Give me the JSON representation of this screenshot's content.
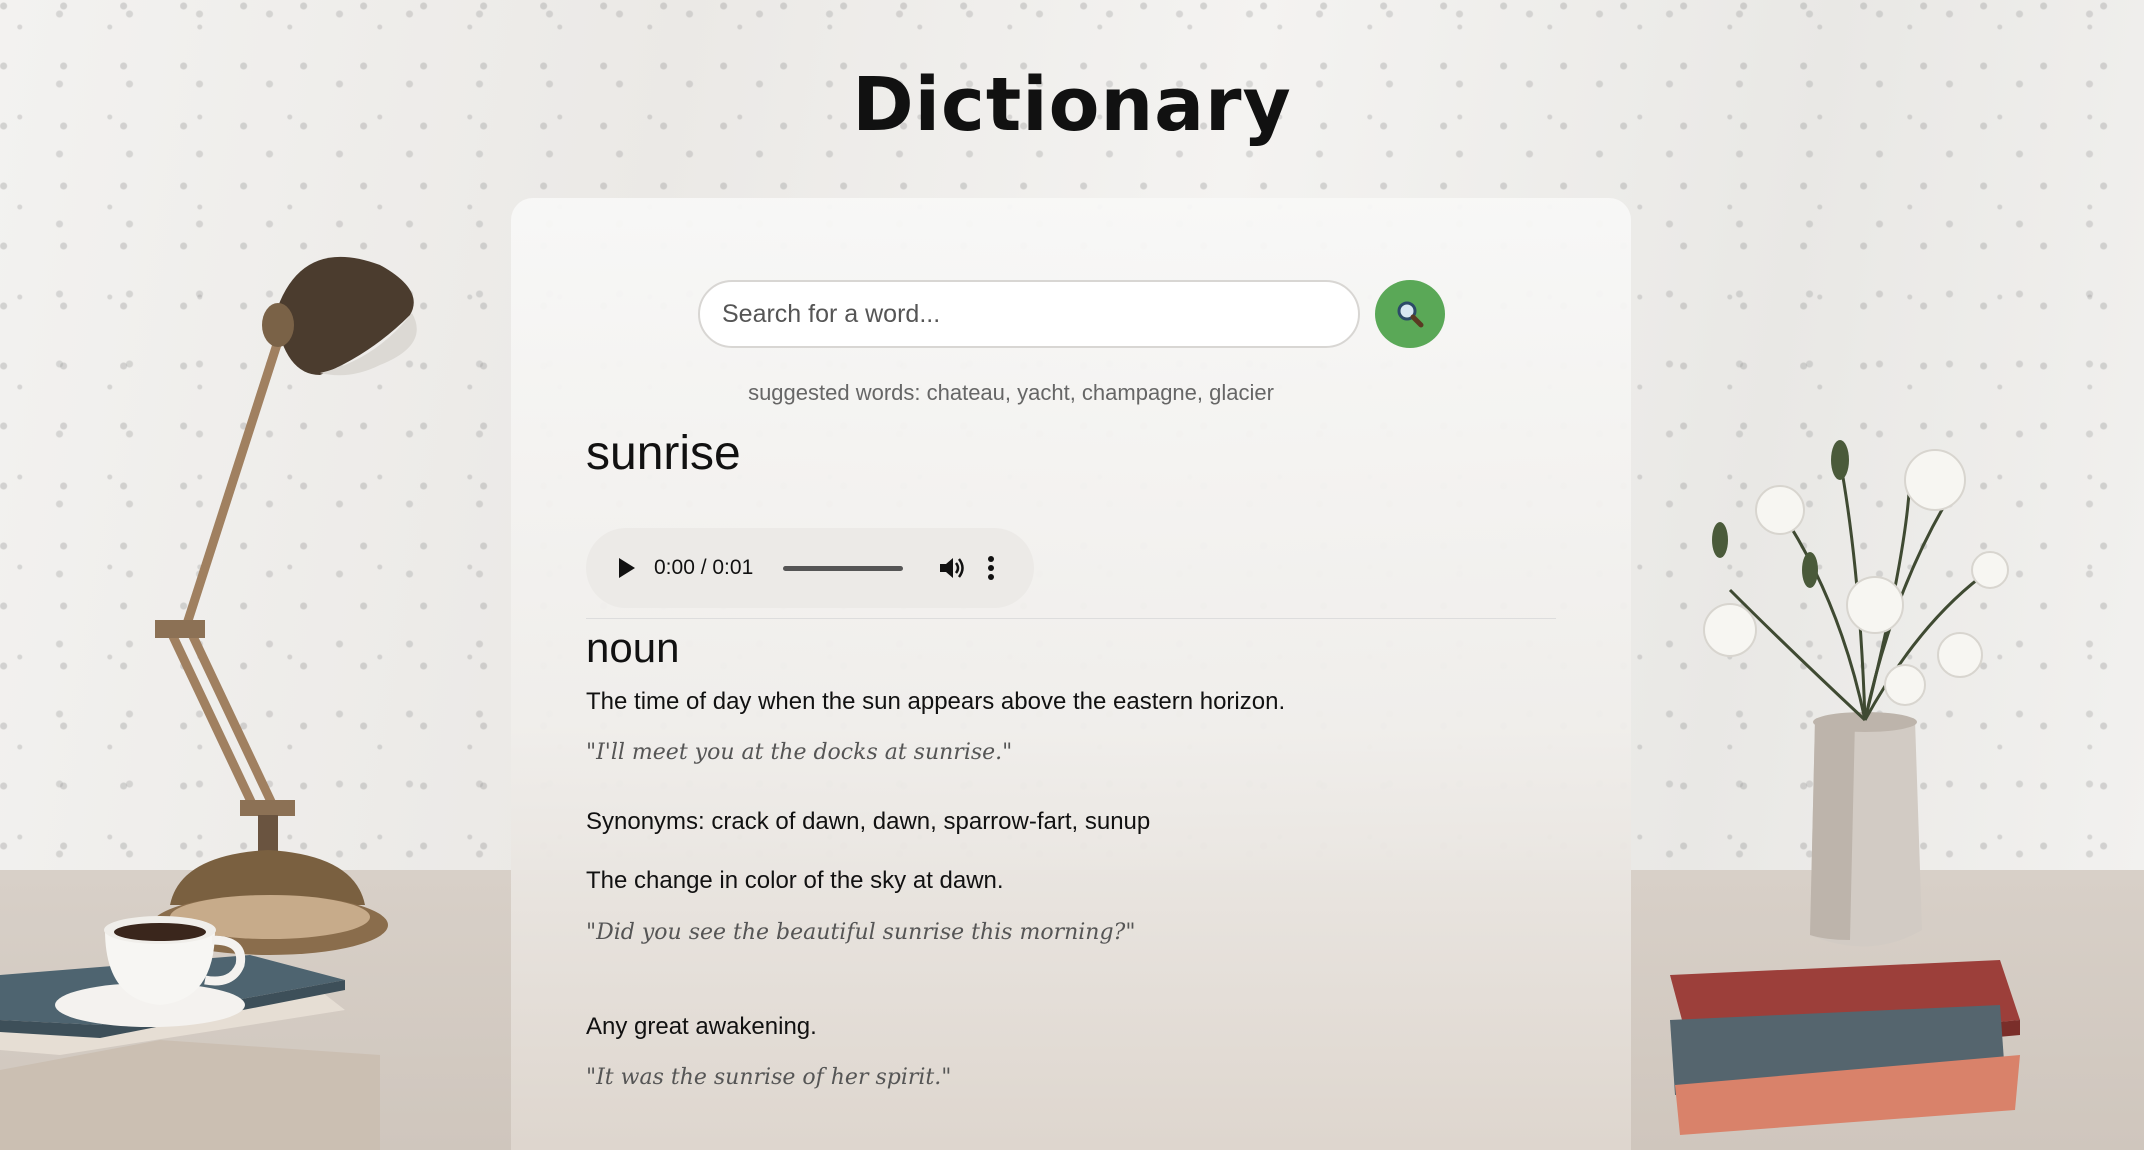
{
  "app": {
    "title": "Dictionary"
  },
  "search": {
    "placeholder": "Search for a word...",
    "button_icon": "magnifier-icon",
    "suggested": "suggested words: chateau, yacht, champagne, glacier"
  },
  "entry": {
    "word": "sunrise",
    "audio": {
      "time": "0:00 / 0:01",
      "progress": 0
    },
    "part_of_speech": "noun",
    "definitions": [
      {
        "text": "The time of day when the sun appears above the eastern horizon.",
        "example": "\"I'll meet you at the docks at sunrise.\""
      },
      {
        "text": "Synonyms: crack of dawn, dawn, sparrow-fart, sunup"
      },
      {
        "text": "The change in color of the sky at dawn.",
        "example": "\"Did you see the beautiful sunrise this morning?\""
      },
      {
        "text": "Any great awakening.",
        "example": "\"It was the sunrise of her spirit.\""
      }
    ]
  },
  "colors": {
    "search_button": "#5aa857",
    "background": "#f1efec",
    "card": "#f7f7f6"
  }
}
